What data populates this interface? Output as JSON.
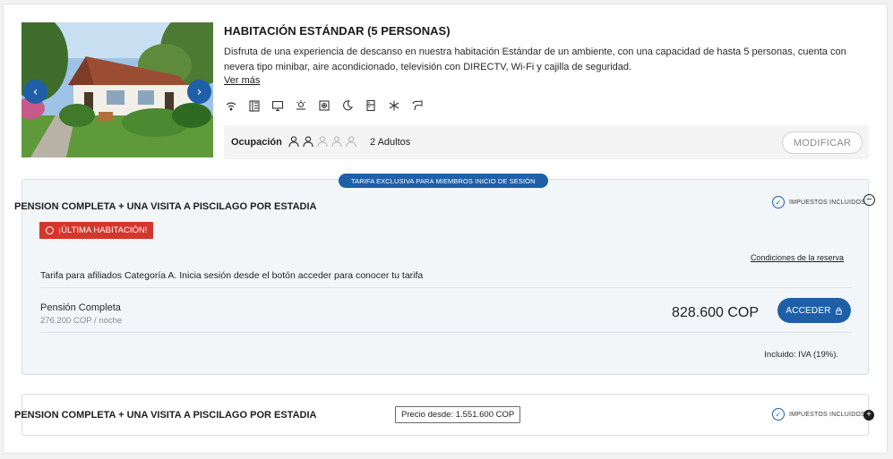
{
  "room": {
    "title": "HABITACIÓN ESTÁNDAR (5 PERSONAS)",
    "description": "Disfruta de una experiencia de descanso en nuestra habitación Estándar de un ambiente, con una capacidad de hasta 5 personas, cuenta con nevera tipo minibar, aire acondicionado, televisión con DIRECTV, Wi-Fi y cajilla de seguridad.",
    "more_link": "Ver más",
    "amenities": [
      "wifi-icon",
      "minibar-icon",
      "tv-icon",
      "weather-icon",
      "safe-icon",
      "night-icon",
      "fridge-icon",
      "air-conditioning-icon",
      "hair-dryer-icon"
    ],
    "carousel": {
      "prev_icon": "chevron-left-icon",
      "next_icon": "chevron-right-icon"
    }
  },
  "occupancy": {
    "label": "Ocupación",
    "summary": "2 Adultos",
    "adults_selected": 2,
    "max_guests": 5,
    "modify_label": "MODIFICAR"
  },
  "rates": [
    {
      "badge": "TARIFA EXCLUSIVA PARA MIEMBROS INICIO DE SESIÓN",
      "title": "PENSION COMPLETA + UNA VISITA A PISCILAGO POR ESTADIA",
      "taxes_label": "IMPUESTOS INCLUIDOS",
      "last_room": "¡ÚLTIMA HABITACIÓN!",
      "conditions_link": "Condiciones de la reserva",
      "note": "Tarifa para afiliados Categoría A. Inicia sesión desde el botón acceder para conocer tu tarifa",
      "plan_name": "Pensión Completa",
      "per_night": "276.200 COP / noche",
      "total": "828.600 COP",
      "action_label": "ACCEDER",
      "included": "Incluido: IVA (19%)."
    },
    {
      "title": "PENSION COMPLETA + UNA VISITA A PISCILAGO POR ESTADIA",
      "price_from": "Precio desde: 1.551.600 COP",
      "taxes_label": "IMPUESTOS INCLUIDOS"
    }
  ],
  "colors": {
    "primary": "#1f5fa8",
    "alert": "#d5362b",
    "panel": "#f3f6f9"
  }
}
